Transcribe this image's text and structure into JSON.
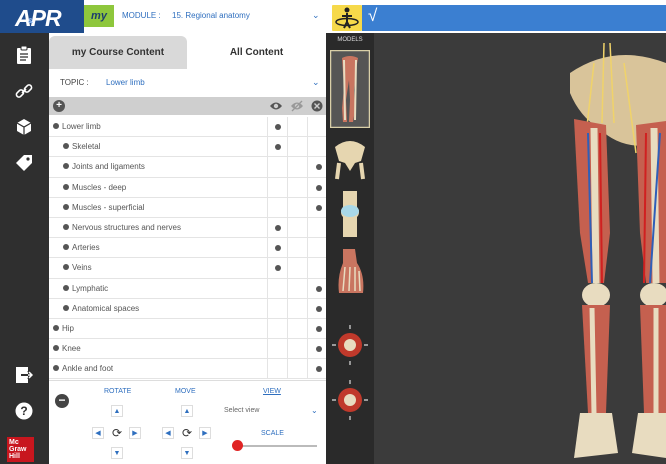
{
  "app": {
    "logo": "APR",
    "logo_amp": "&",
    "my_badge": "my",
    "module_label": "MODULE :",
    "module_value": "15. Regional anatomy"
  },
  "sidebar": {
    "icons": [
      "clipboard-icon",
      "link-icon",
      "cube-icon",
      "tag-icon",
      "exit-icon",
      "help-icon"
    ],
    "publisher_logo": "Mc Graw Hill"
  },
  "tabs": [
    {
      "label": "my Course Content",
      "active": false
    },
    {
      "label": "All Content",
      "active": true
    }
  ],
  "topic": {
    "label": "TOPIC :",
    "value": "Lower limb"
  },
  "rows": [
    {
      "label": "Lower limb",
      "indent": 0,
      "dots": [
        1,
        0,
        0
      ]
    },
    {
      "label": "Skeletal",
      "indent": 1,
      "dots": [
        1,
        0,
        0
      ]
    },
    {
      "label": "Joints and ligaments",
      "indent": 1,
      "dots": [
        0,
        0,
        1
      ]
    },
    {
      "label": "Muscles - deep",
      "indent": 1,
      "dots": [
        0,
        0,
        1
      ]
    },
    {
      "label": "Muscles - superficial",
      "indent": 1,
      "dots": [
        0,
        0,
        1
      ]
    },
    {
      "label": "Nervous structures and nerves",
      "indent": 1,
      "dots": [
        1,
        0,
        0
      ]
    },
    {
      "label": "Arteries",
      "indent": 1,
      "dots": [
        1,
        0,
        0
      ]
    },
    {
      "label": "Veins",
      "indent": 1,
      "dots": [
        1,
        0,
        0
      ]
    },
    {
      "label": "Lymphatic",
      "indent": 1,
      "dots": [
        0,
        0,
        1
      ]
    },
    {
      "label": "Anatomical spaces",
      "indent": 1,
      "dots": [
        0,
        0,
        1
      ]
    },
    {
      "label": "Hip",
      "indent": 0,
      "dots": [
        0,
        0,
        1
      ]
    },
    {
      "label": "Knee",
      "indent": 0,
      "dots": [
        0,
        0,
        1
      ]
    },
    {
      "label": "Ankle and foot",
      "indent": 0,
      "dots": [
        0,
        0,
        1
      ]
    }
  ],
  "controls": {
    "rotate_label": "ROTATE",
    "move_label": "MOVE",
    "view_label": "VIEW",
    "select_view": "Select view",
    "scale_label": "SCALE",
    "scale_value": 0
  },
  "models": {
    "label": "MODELS",
    "items": [
      "full-leg-model",
      "pelvis-model",
      "knee-model",
      "foot-model",
      "cross-section-thigh-model",
      "cross-section-leg-model"
    ],
    "selected_index": 0
  },
  "colors": {
    "brand_blue": "#1f4c8c",
    "accent_blue": "#2f6fbf",
    "my_green": "#8ec73c",
    "tool_yellow": "#f6d94a",
    "strip_blue": "#3b7fd1",
    "slider_red": "#e02424",
    "mh_red": "#c8161e"
  }
}
